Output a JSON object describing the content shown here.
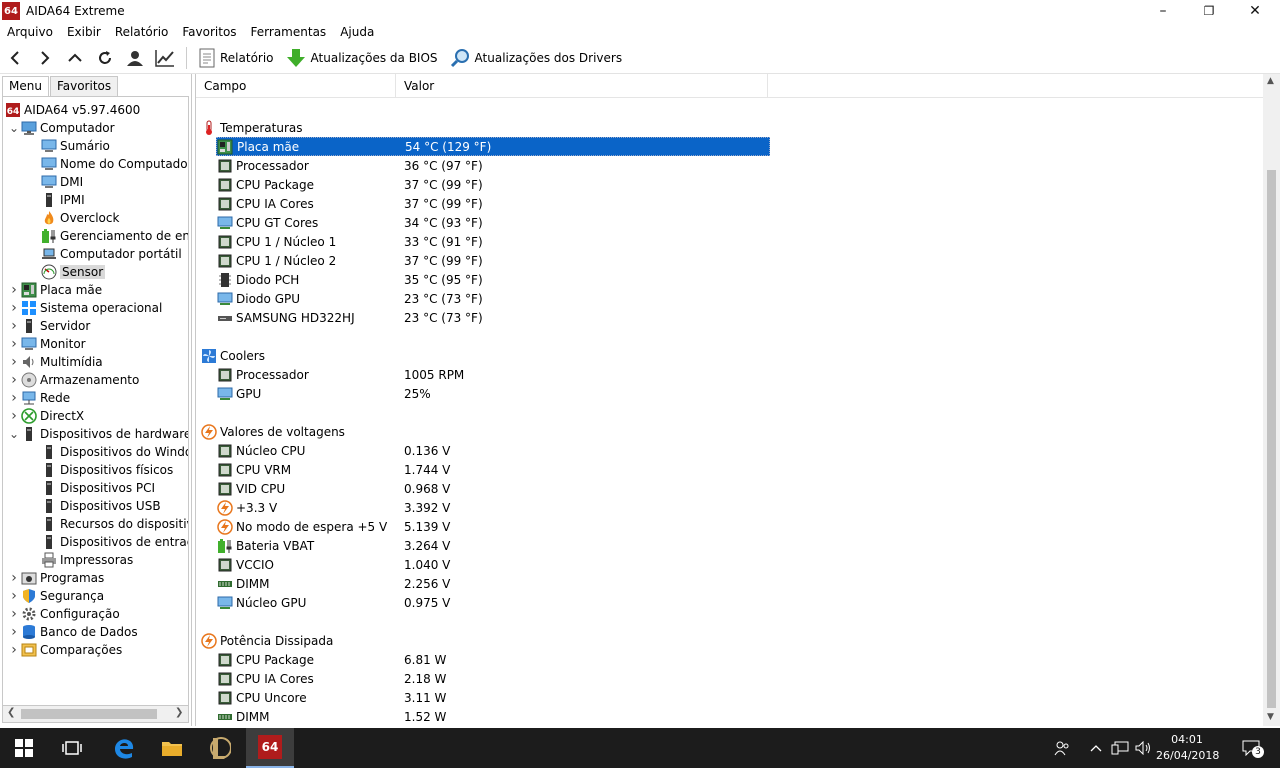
{
  "window": {
    "logo": "64",
    "title": "AIDA64 Extreme",
    "minimize": "–",
    "maximize": "❐",
    "close": "✕"
  },
  "menu": [
    "Arquivo",
    "Exibir",
    "Relatório",
    "Favoritos",
    "Ferramentas",
    "Ajuda"
  ],
  "toolbar": {
    "report": "Relatório",
    "bios_updates": "Atualizações da BIOS",
    "driver_updates": "Atualizações dos Drivers"
  },
  "tabs": [
    "Menu",
    "Favoritos"
  ],
  "tree": [
    {
      "label": "AIDA64 v5.97.4600",
      "icon": "aida-icon"
    },
    {
      "label": "Computador",
      "icon": "computer-icon"
    },
    {
      "label": "Sumário",
      "icon": "monitor-icon"
    },
    {
      "label": "Nome do Computador",
      "icon": "monitor-icon"
    },
    {
      "label": "DMI",
      "icon": "monitor-icon"
    },
    {
      "label": "IPMI",
      "icon": "device-icon"
    },
    {
      "label": "Overclock",
      "icon": "flame-icon"
    },
    {
      "label": "Gerenciamento de energia",
      "icon": "battery-icon"
    },
    {
      "label": "Computador portátil",
      "icon": "laptop-icon"
    },
    {
      "label": "Sensor",
      "icon": "gauge-icon"
    },
    {
      "label": "Placa mãe",
      "icon": "motherboard-icon"
    },
    {
      "label": "Sistema operacional",
      "icon": "windows-icon"
    },
    {
      "label": "Servidor",
      "icon": "device-icon"
    },
    {
      "label": "Monitor",
      "icon": "monitor-icon"
    },
    {
      "label": "Multimídia",
      "icon": "speaker-icon"
    },
    {
      "label": "Armazenamento",
      "icon": "disk-icon"
    },
    {
      "label": "Rede",
      "icon": "network-icon"
    },
    {
      "label": "DirectX",
      "icon": "xbox-icon"
    },
    {
      "label": "Dispositivos de hardware",
      "icon": "device-icon"
    },
    {
      "label": "Dispositivos do Windows",
      "icon": "device-icon"
    },
    {
      "label": "Dispositivos físicos",
      "icon": "device-icon"
    },
    {
      "label": "Dispositivos PCI",
      "icon": "device-icon"
    },
    {
      "label": "Dispositivos USB",
      "icon": "device-icon"
    },
    {
      "label": "Recursos do dispositivo",
      "icon": "device-icon"
    },
    {
      "label": "Dispositivos de entrada",
      "icon": "device-icon"
    },
    {
      "label": "Impressoras",
      "icon": "printer-icon"
    },
    {
      "label": "Programas",
      "icon": "programs-icon"
    },
    {
      "label": "Segurança",
      "icon": "shield-icon"
    },
    {
      "label": "Configuração",
      "icon": "config-icon"
    },
    {
      "label": "Banco de Dados",
      "icon": "database-icon"
    },
    {
      "label": "Comparações",
      "icon": "compare-icon"
    }
  ],
  "columns": {
    "field": "Campo",
    "value": "Valor"
  },
  "groups": {
    "temperatures": {
      "title": "Temperaturas",
      "rows": [
        {
          "field": "Placa mãe",
          "value": "54 °C  (129 °F)"
        },
        {
          "field": "Processador",
          "value": "36 °C  (97 °F)"
        },
        {
          "field": "CPU Package",
          "value": "37 °C  (99 °F)"
        },
        {
          "field": "CPU IA Cores",
          "value": "37 °C  (99 °F)"
        },
        {
          "field": "CPU GT Cores",
          "value": "34 °C  (93 °F)"
        },
        {
          "field": "CPU 1 / Núcleo 1",
          "value": "33 °C  (91 °F)"
        },
        {
          "field": "CPU 1 / Núcleo 2",
          "value": "37 °C  (99 °F)"
        },
        {
          "field": "Diodo PCH",
          "value": "35 °C  (95 °F)"
        },
        {
          "field": "Diodo GPU",
          "value": "23 °C  (73 °F)"
        },
        {
          "field": "SAMSUNG HD322HJ",
          "value": "23 °C  (73 °F)"
        }
      ]
    },
    "coolers": {
      "title": "Coolers",
      "rows": [
        {
          "field": "Processador",
          "value": "1005 RPM"
        },
        {
          "field": "GPU",
          "value": "25%"
        }
      ]
    },
    "voltages": {
      "title": "Valores de voltagens",
      "rows": [
        {
          "field": "Núcleo CPU",
          "value": "0.136 V"
        },
        {
          "field": "CPU VRM",
          "value": "1.744 V"
        },
        {
          "field": "VID CPU",
          "value": "0.968 V"
        },
        {
          "field": "+3.3 V",
          "value": "3.392 V"
        },
        {
          "field": "No modo de espera +5 V",
          "value": "5.139 V"
        },
        {
          "field": "Bateria VBAT",
          "value": "3.264 V"
        },
        {
          "field": "VCCIO",
          "value": "1.040 V"
        },
        {
          "field": "DIMM",
          "value": "2.256 V"
        },
        {
          "field": "Núcleo GPU",
          "value": "0.975 V"
        }
      ]
    },
    "power": {
      "title": "Potência Dissipada",
      "rows": [
        {
          "field": "CPU Package",
          "value": "6.81 W"
        },
        {
          "field": "CPU IA Cores",
          "value": "2.18 W"
        },
        {
          "field": "CPU Uncore",
          "value": "3.11 W"
        },
        {
          "field": "DIMM",
          "value": "1.52 W"
        }
      ]
    }
  },
  "taskbar": {
    "aida_label": "64",
    "time": "04:01",
    "date": "26/04/2018",
    "notifications": "3"
  },
  "colors": {
    "selection": "#0a64c8",
    "aida_red": "#b01c1c",
    "taskbar": "#1c1c1c"
  }
}
